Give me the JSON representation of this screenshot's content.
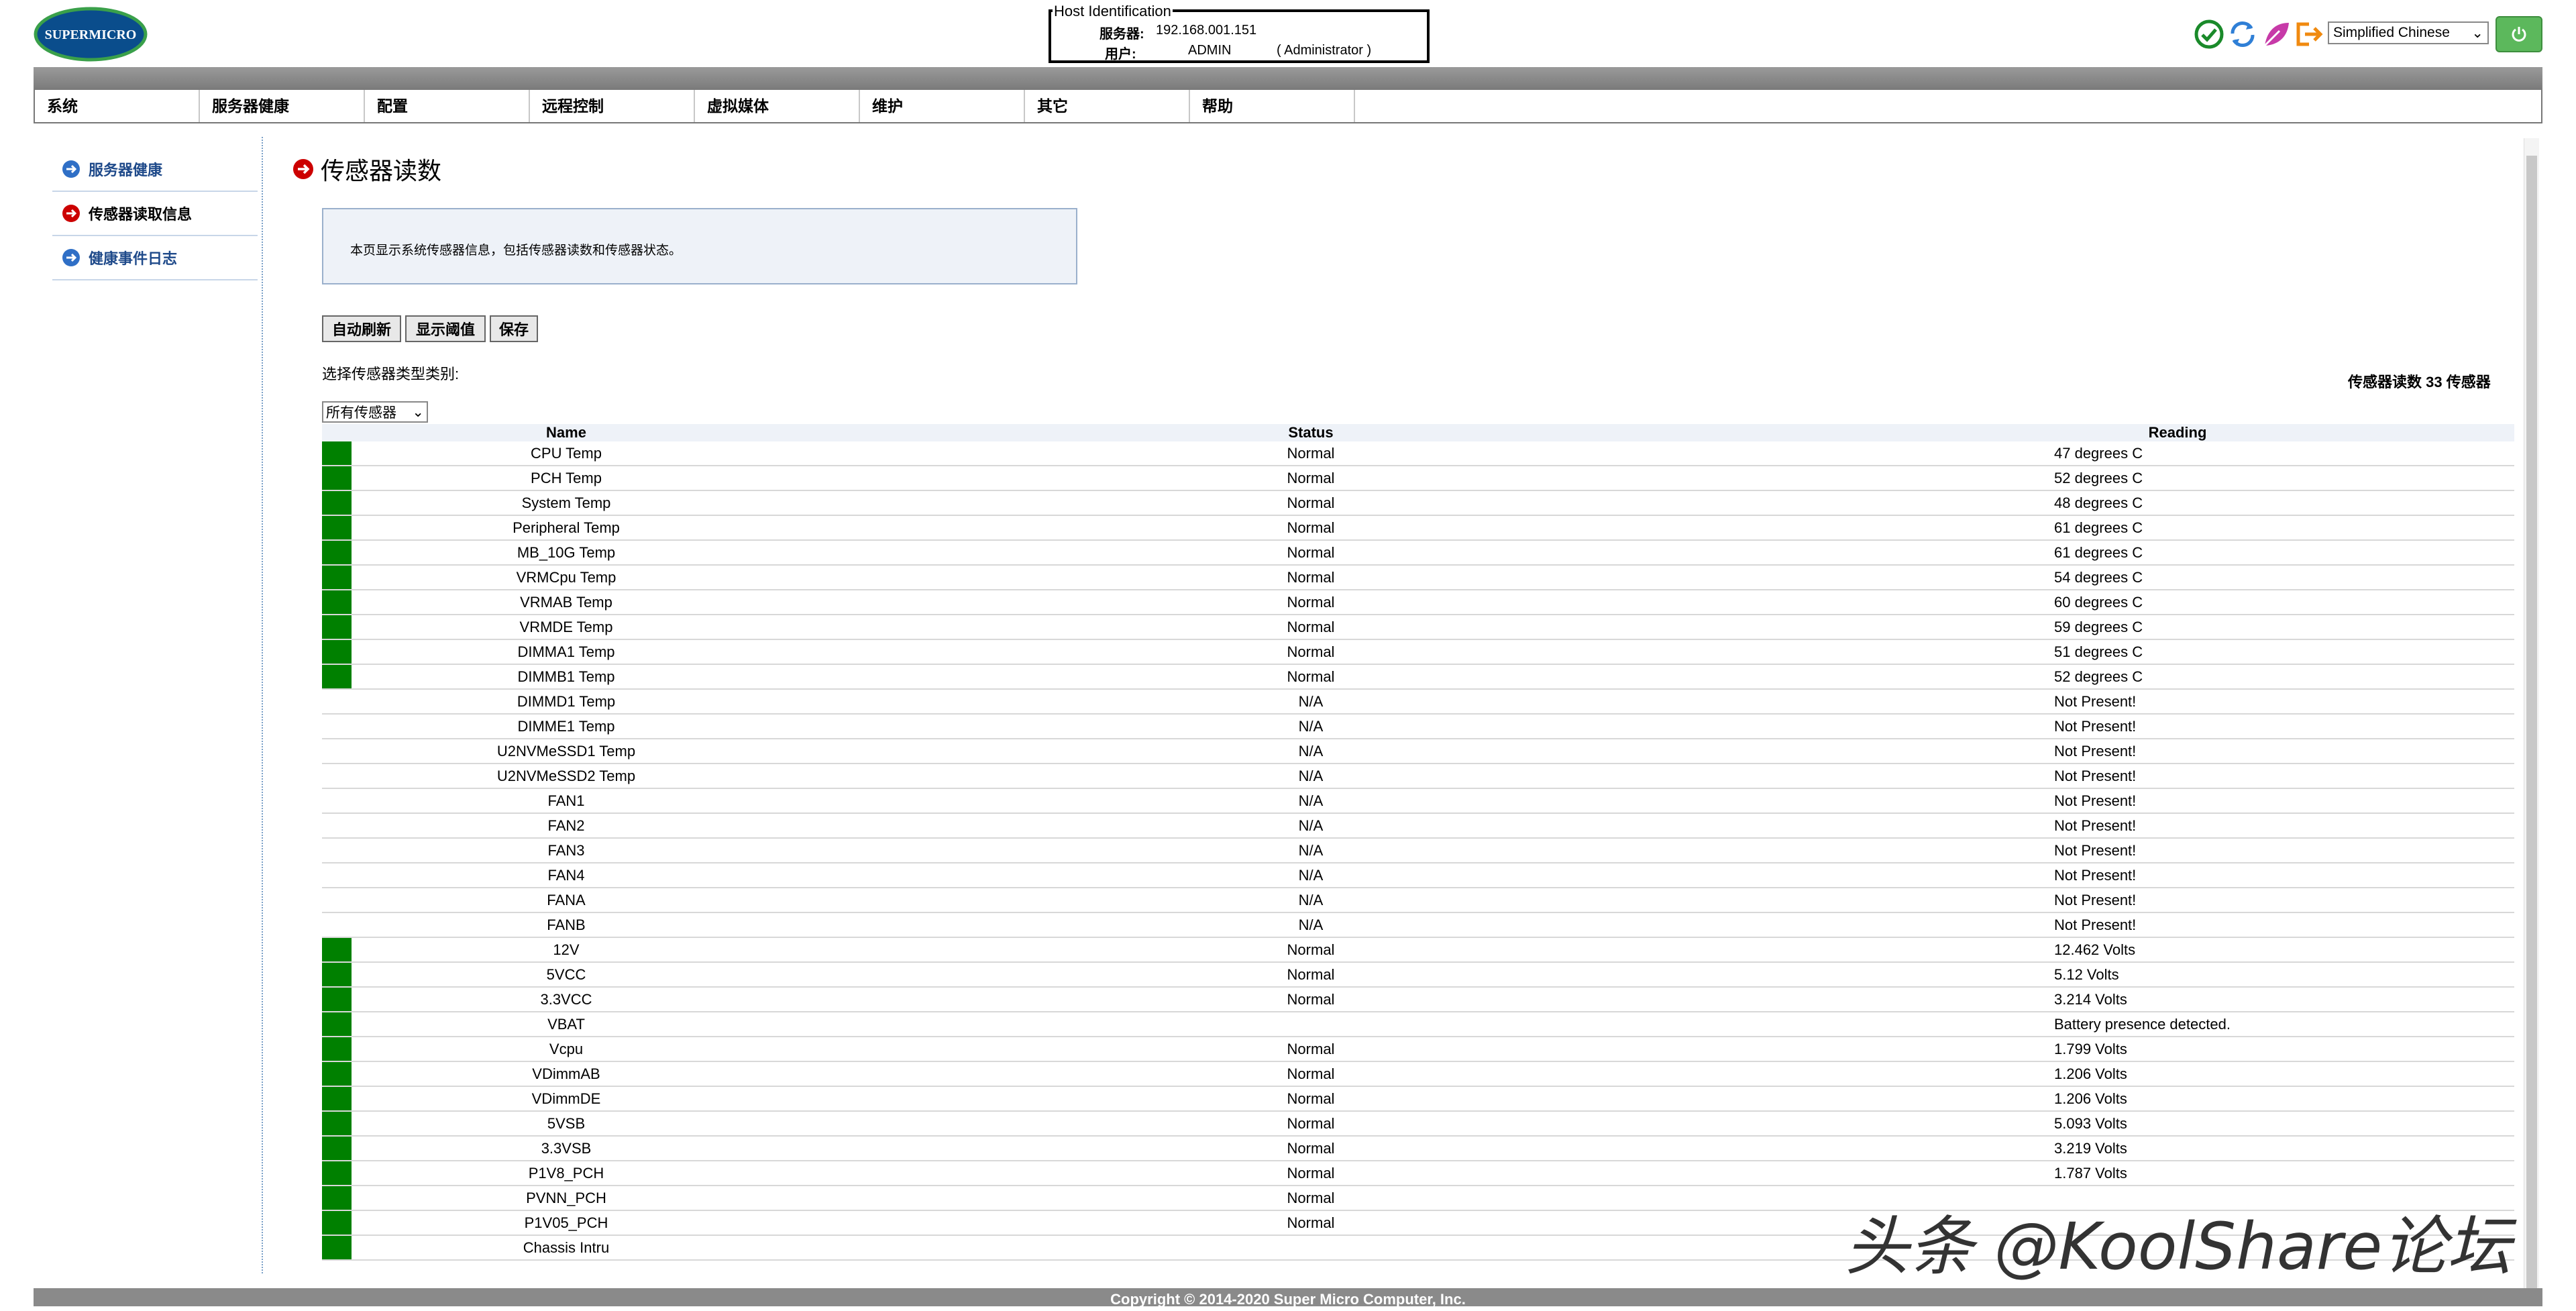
{
  "brand": "SUPERMICRO",
  "host": {
    "legend": "Host Identification",
    "server_label": "服务器:",
    "server_value": "192.168.001.151",
    "user_label": "用户:",
    "user_value": "ADMIN",
    "user_role": "( Administrator )"
  },
  "language": {
    "selected": "Simplified Chinese"
  },
  "menu": [
    "系统",
    "服务器健康",
    "配置",
    "远程控制",
    "虚拟媒体",
    "维护",
    "其它",
    "帮助"
  ],
  "sidebar": [
    {
      "label": "服务器健康",
      "active": false
    },
    {
      "label": "传感器读取信息",
      "active": true
    },
    {
      "label": "健康事件日志",
      "active": false
    }
  ],
  "page": {
    "title": "传感器读数",
    "description": "本页显示系统传感器信息，包括传感器读数和传感器状态。",
    "buttons": {
      "auto_refresh": "自动刷新",
      "show_threshold": "显示阈值",
      "save": "保存"
    },
    "category_label": "选择传感器类型类别:",
    "category_selected": "所有传感器",
    "count_text": "传感器读数 33 传感器"
  },
  "table": {
    "columns": [
      "Name",
      "Status",
      "Reading"
    ],
    "rows": [
      {
        "name": "CPU Temp",
        "status": "Normal",
        "reading": "47 degrees C",
        "ok": true
      },
      {
        "name": "PCH Temp",
        "status": "Normal",
        "reading": "52 degrees C",
        "ok": true
      },
      {
        "name": "System Temp",
        "status": "Normal",
        "reading": "48 degrees C",
        "ok": true
      },
      {
        "name": "Peripheral Temp",
        "status": "Normal",
        "reading": "61 degrees C",
        "ok": true
      },
      {
        "name": "MB_10G Temp",
        "status": "Normal",
        "reading": "61 degrees C",
        "ok": true
      },
      {
        "name": "VRMCpu Temp",
        "status": "Normal",
        "reading": "54 degrees C",
        "ok": true
      },
      {
        "name": "VRMAB Temp",
        "status": "Normal",
        "reading": "60 degrees C",
        "ok": true
      },
      {
        "name": "VRMDE Temp",
        "status": "Normal",
        "reading": "59 degrees C",
        "ok": true
      },
      {
        "name": "DIMMA1 Temp",
        "status": "Normal",
        "reading": "51 degrees C",
        "ok": true
      },
      {
        "name": "DIMMB1 Temp",
        "status": "Normal",
        "reading": "52 degrees C",
        "ok": true
      },
      {
        "name": "DIMMD1 Temp",
        "status": "N/A",
        "reading": "Not Present!",
        "ok": false
      },
      {
        "name": "DIMME1 Temp",
        "status": "N/A",
        "reading": "Not Present!",
        "ok": false
      },
      {
        "name": "U2NVMeSSD1 Temp",
        "status": "N/A",
        "reading": "Not Present!",
        "ok": false
      },
      {
        "name": "U2NVMeSSD2 Temp",
        "status": "N/A",
        "reading": "Not Present!",
        "ok": false
      },
      {
        "name": "FAN1",
        "status": "N/A",
        "reading": "Not Present!",
        "ok": false
      },
      {
        "name": "FAN2",
        "status": "N/A",
        "reading": "Not Present!",
        "ok": false
      },
      {
        "name": "FAN3",
        "status": "N/A",
        "reading": "Not Present!",
        "ok": false
      },
      {
        "name": "FAN4",
        "status": "N/A",
        "reading": "Not Present!",
        "ok": false
      },
      {
        "name": "FANA",
        "status": "N/A",
        "reading": "Not Present!",
        "ok": false
      },
      {
        "name": "FANB",
        "status": "N/A",
        "reading": "Not Present!",
        "ok": false
      },
      {
        "name": "12V",
        "status": "Normal",
        "reading": "12.462 Volts",
        "ok": true
      },
      {
        "name": "5VCC",
        "status": "Normal",
        "reading": "5.12 Volts",
        "ok": true
      },
      {
        "name": "3.3VCC",
        "status": "Normal",
        "reading": "3.214 Volts",
        "ok": true
      },
      {
        "name": "VBAT",
        "status": "",
        "reading": "Battery presence detected.",
        "ok": true
      },
      {
        "name": "Vcpu",
        "status": "Normal",
        "reading": "1.799 Volts",
        "ok": true
      },
      {
        "name": "VDimmAB",
        "status": "Normal",
        "reading": "1.206 Volts",
        "ok": true
      },
      {
        "name": "VDimmDE",
        "status": "Normal",
        "reading": "1.206 Volts",
        "ok": true
      },
      {
        "name": "5VSB",
        "status": "Normal",
        "reading": "5.093 Volts",
        "ok": true
      },
      {
        "name": "3.3VSB",
        "status": "Normal",
        "reading": "3.219 Volts",
        "ok": true
      },
      {
        "name": "P1V8_PCH",
        "status": "Normal",
        "reading": "1.787 Volts",
        "ok": true
      },
      {
        "name": "PVNN_PCH",
        "status": "Normal",
        "reading": "",
        "ok": true
      },
      {
        "name": "P1V05_PCH",
        "status": "Normal",
        "reading": "",
        "ok": true
      },
      {
        "name": "Chassis Intru",
        "status": "",
        "reading": "",
        "ok": true
      }
    ]
  },
  "footer": "Copyright © 2014-2020 Super Micro Computer, Inc.",
  "watermark": "头条 @KoolShare论坛",
  "colors": {
    "ok": "#008000",
    "nav_blue": "#1f4a8a",
    "active_red": "#cc0000"
  }
}
